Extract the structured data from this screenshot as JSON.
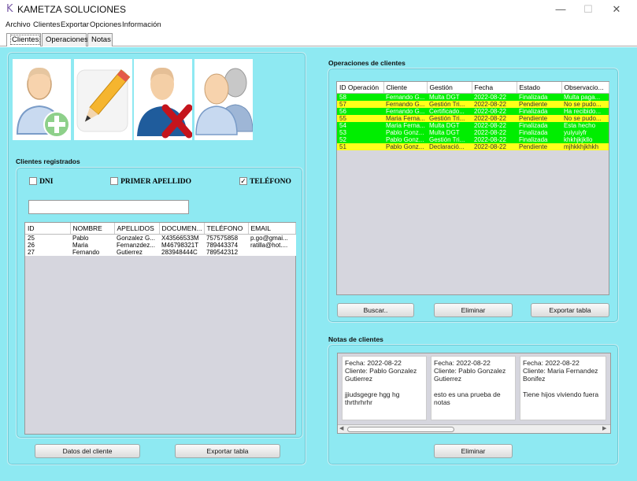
{
  "window": {
    "logo": "K",
    "title": "KAMETZA SOLUCIONES",
    "minimize": "—",
    "maximize": "☐",
    "close": "✕"
  },
  "menu": [
    "Archivo",
    "Clientes",
    "Exportar",
    "Opciones",
    "Información"
  ],
  "tabs": [
    "Clientes",
    "Operaciones",
    "Notas"
  ],
  "clientes_panel": {
    "title": "Clientes registrados",
    "filters": [
      {
        "label": "DNI",
        "checked": false
      },
      {
        "label": "PRIMER APELLIDO",
        "checked": false
      },
      {
        "label": "TELÉFONO",
        "checked": true
      }
    ],
    "search_value": "",
    "columns": [
      "ID",
      "NOMBRE",
      "APELLIDOS",
      "DOCUMEN...",
      "TELÉFONO",
      "EMAIL"
    ],
    "rows": [
      [
        "25",
        "Pablo",
        "Gonzalez G...",
        "X43566533M",
        "757575858",
        "p.go@gmai..."
      ],
      [
        "26",
        "Maria",
        "Fernanzdez...",
        "M46798321T",
        "789443374",
        "ratilla@hot...."
      ],
      [
        "27",
        "Fernando",
        "Gutierrez",
        "283948444C",
        "789542312",
        ""
      ]
    ],
    "btn_datos": "Datos del cliente",
    "btn_exportar": "Exportar tabla"
  },
  "operaciones_panel": {
    "title": "Operaciones de clientes",
    "columns": [
      "ID Operación",
      "Cliente",
      "Gestión",
      "Fecha",
      "Estado",
      "Observacio..."
    ],
    "rows": [
      [
        "58",
        "Fernando G...",
        "Multa DGT",
        "2022-08-22",
        "Finalizada",
        "Multa paga..."
      ],
      [
        "57",
        "Fernando G...",
        "Gestión Tri...",
        "2022-08-22",
        "Pendiente",
        "No se pudo..."
      ],
      [
        "56",
        "Fernando G...",
        "Certificado...",
        "2022-08-22",
        "Finalizada",
        "Ha recibido..."
      ],
      [
        "55",
        "Maria Ferna...",
        "Gestión Tri...",
        "2022-08-22",
        "Pendiente",
        "No se pudo..."
      ],
      [
        "54",
        "Maria Ferna...",
        "Multa DGT",
        "2022-08-22",
        "Finalizada",
        "Esta hecho"
      ],
      [
        "53",
        "Pablo Gonz...",
        "Multa DGT",
        "2022-08-22",
        "Finalizada",
        "yuiyuiyfr"
      ],
      [
        "52",
        "Pablo Gonz...",
        "Gestión Tri...",
        "2022-08-22",
        "Finalizada",
        "khkhjkjkllo"
      ],
      [
        "51",
        "Pablo Gonz...",
        "Declaració...",
        "2022-08-22",
        "Pendiente",
        "mjhkkhjkhkh"
      ]
    ],
    "status_colors": {
      "Finalizada": "#00ee00",
      "Pendiente": "#ffff1a"
    },
    "btn_buscar": "Buscar..",
    "btn_eliminar": "Eliminar",
    "btn_exportar": "Exportar tabla"
  },
  "notas_panel": {
    "title": "Notas de clientes",
    "notes": [
      {
        "fecha": "Fecha: 2022-08-22",
        "cliente": "Cliente: Pablo Gonzalez Gutierrez",
        "texto": "jjiudsgegre hgg hg thrthrhrhr"
      },
      {
        "fecha": "Fecha: 2022-08-22",
        "cliente": "Cliente: Pablo Gonzalez Gutierrez",
        "texto": "esto es una prueba de notas"
      },
      {
        "fecha": "Fecha: 2022-08-22",
        "cliente": "Cliente: Maria Fernandez Bonifez",
        "texto": "Tiene hijos viviendo fuera"
      }
    ],
    "btn_eliminar": "Eliminar"
  },
  "colors": {
    "background": "#8ee9f2",
    "accent_logo": "#7b5ca8"
  }
}
